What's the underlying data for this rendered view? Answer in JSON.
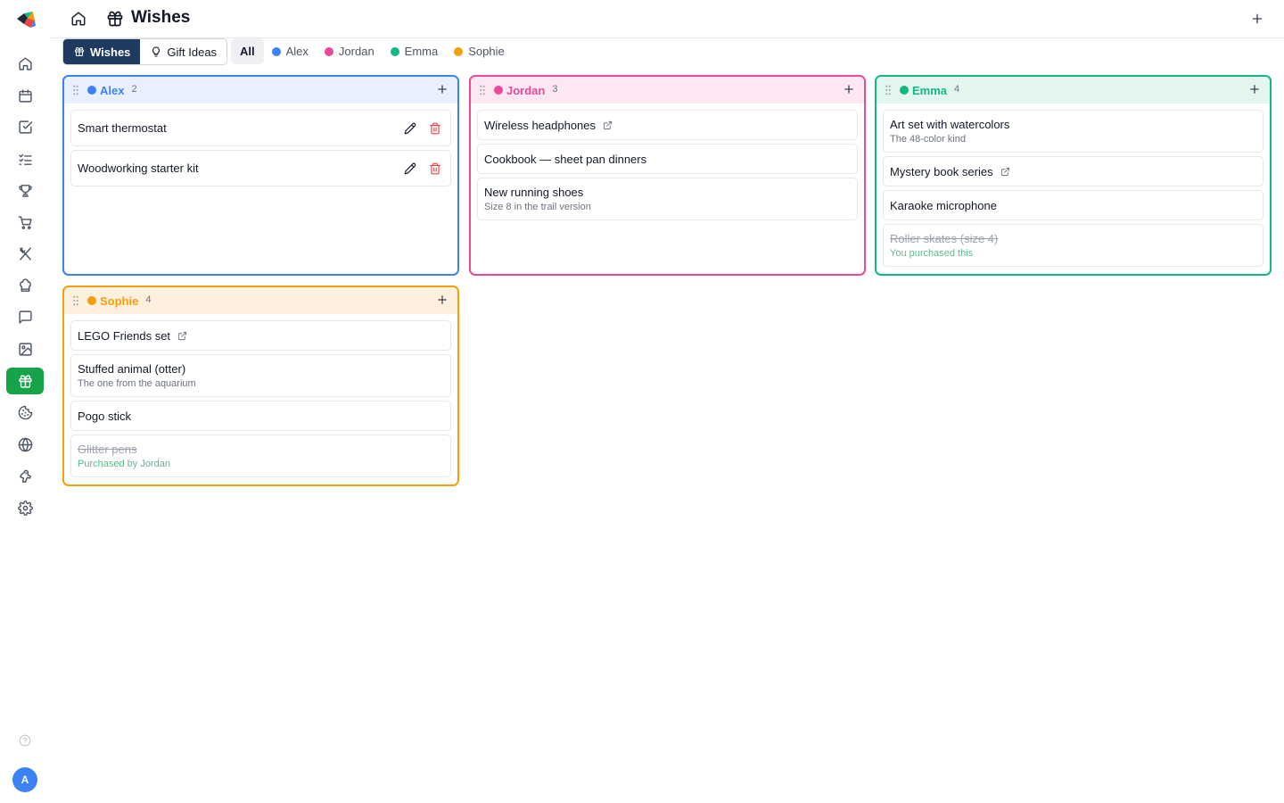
{
  "header": {
    "title": "Wishes"
  },
  "view_toggle": [
    {
      "label": "Wishes",
      "active": true
    },
    {
      "label": "Gift Ideas",
      "active": false
    }
  ],
  "filters": [
    {
      "label": "All",
      "active": true
    },
    {
      "label": "Alex",
      "color": "#3b82f6"
    },
    {
      "label": "Jordan",
      "color": "#ec4899"
    },
    {
      "label": "Emma",
      "color": "#10b981"
    },
    {
      "label": "Sophie",
      "color": "#f59e0b"
    }
  ],
  "sidebar": {
    "items": [
      "home-icon",
      "calendar-icon",
      "checkbox-icon",
      "list-checks-icon",
      "trophy-icon",
      "cart-icon",
      "utensils-icon",
      "chef-hat-icon",
      "message-icon",
      "image-icon",
      "gift-icon",
      "cookie-icon",
      "globe-icon",
      "dog-icon",
      "settings-icon"
    ],
    "active": "gift-icon",
    "avatar": "A"
  },
  "columns": [
    {
      "name": "Alex",
      "count": "2",
      "color": "#3b82f6",
      "bg": "#e8f0fe",
      "items": [
        {
          "title": "Smart thermostat"
        },
        {
          "title": "Woodworking starter kit"
        }
      ]
    },
    {
      "name": "Jordan",
      "count": "3",
      "color": "#ec4899",
      "bg": "#fce7f3",
      "items": [
        {
          "title": "Wireless headphones"
        },
        {
          "title": "Cookbook — sheet pan dinners"
        },
        {
          "title": "New running shoes",
          "sub": "Size 8 in the trail version"
        }
      ]
    },
    {
      "name": "Emma",
      "count": "4",
      "color": "#10b981",
      "bg": "#e3f6ee",
      "items": [
        {
          "title": "Art set with watercolors",
          "sub": "The 48-color kind"
        },
        {
          "title": "Mystery book series"
        },
        {
          "title": "Karaoke microphone"
        },
        {
          "title": "Roller skates (size 4)",
          "sub": "You purchased this"
        }
      ]
    },
    {
      "name": "Sophie",
      "count": "4",
      "color": "#f59e0b",
      "bg": "#fdf0df",
      "items": [
        {
          "title": "LEGO Friends set"
        },
        {
          "title": "Stuffed animal (otter)",
          "sub": "The one from the aquarium"
        },
        {
          "title": "Pogo stick"
        },
        {
          "title": "Glitter pens",
          "sub": "Purchased by Jordan"
        }
      ]
    }
  ]
}
